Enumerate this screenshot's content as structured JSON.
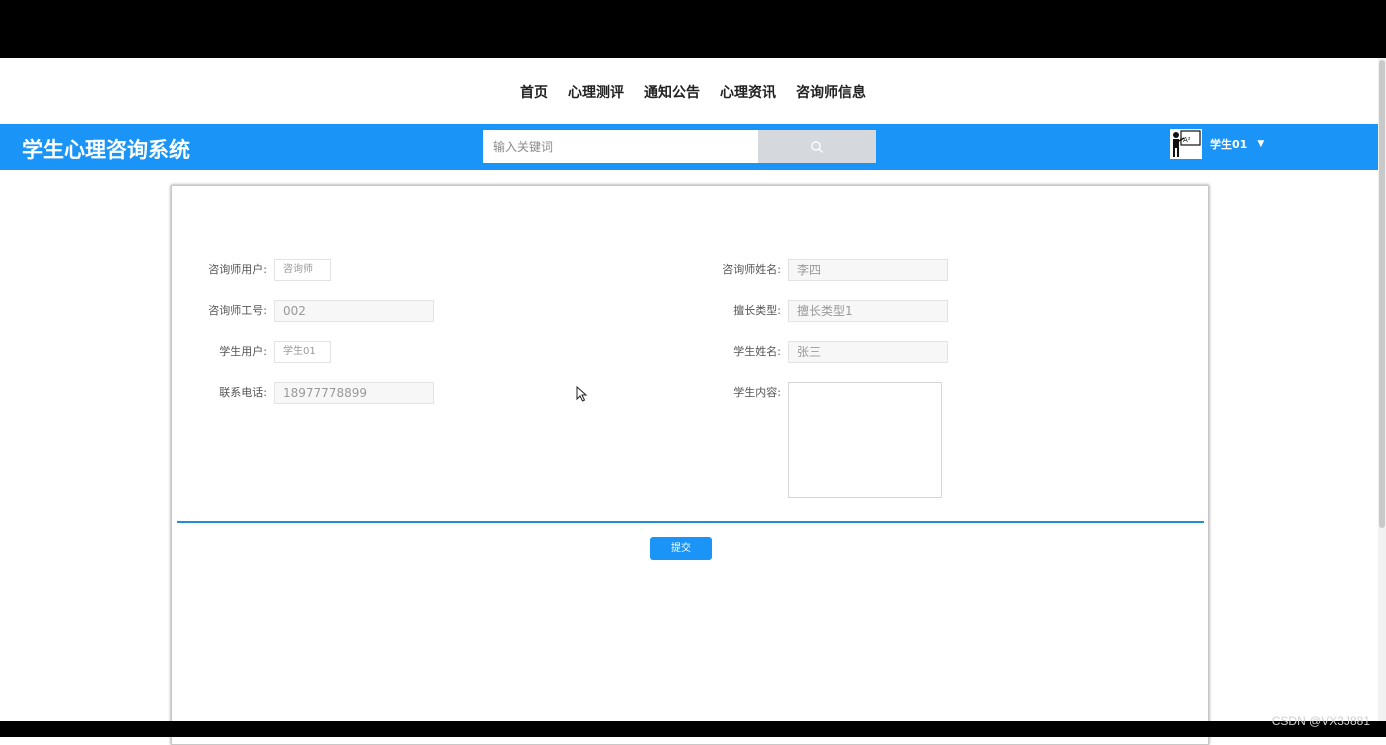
{
  "nav": {
    "items": [
      "首页",
      "心理测评",
      "通知公告",
      "心理资讯",
      "咨询师信息"
    ]
  },
  "header": {
    "brand": "学生心理咨询系统",
    "search_placeholder": "输入关键词",
    "search_icon": "search-icon",
    "user_name": "学生01",
    "caret_icon": "chevron-down-icon"
  },
  "form": {
    "counselor_user_label": "咨询师用户:",
    "counselor_user_value": "咨询师",
    "counselor_name_label": "咨询师姓名:",
    "counselor_name_value": "李四",
    "counselor_id_label": "咨询师工号:",
    "counselor_id_value": "002",
    "specialty_label": "擅长类型:",
    "specialty_value": "擅长类型1",
    "student_user_label": "学生用户:",
    "student_user_value": "学生01",
    "student_name_label": "学生姓名:",
    "student_name_value": "张三",
    "phone_label": "联系电话:",
    "phone_value": "18977778899",
    "content_label": "学生内容:",
    "content_value": "",
    "submit_label": "提交"
  },
  "watermark": "CSDN @VX3J881",
  "colors": {
    "accent": "#1a94f6",
    "divider": "#1f8fd1",
    "search_button": "#d5d8dd"
  }
}
